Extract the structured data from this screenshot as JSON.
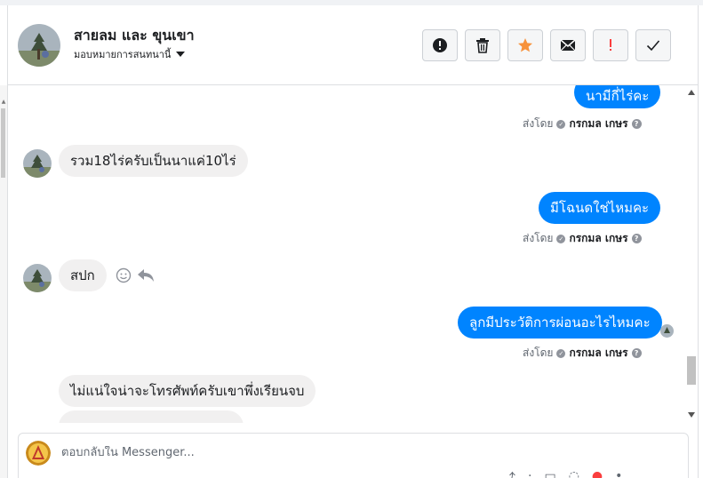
{
  "header": {
    "title": "สายลม และ ขุนเขา",
    "assign_label": "มอบหมายการสนทนานี้"
  },
  "actions": [
    {
      "name": "report-spam-button",
      "icon": "!",
      "icon_name": "exclamation-circle-icon",
      "color": "#1c1e21"
    },
    {
      "name": "delete-button",
      "icon": "🗑",
      "icon_name": "trash-icon",
      "color": "#1c1e21"
    },
    {
      "name": "star-button",
      "icon": "★",
      "icon_name": "star-icon",
      "color": "#f7923b"
    },
    {
      "name": "mark-unread-button",
      "icon": "✉",
      "icon_name": "envelope-icon",
      "color": "#1c1e21"
    },
    {
      "name": "follow-up-button",
      "icon": "!",
      "icon_name": "red-exclamation-icon",
      "color": "#fa3e3e"
    },
    {
      "name": "mark-done-button",
      "icon": "✓",
      "icon_name": "checkmark-icon",
      "color": "#1c1e21"
    }
  ],
  "messages": {
    "m1": "นามีกี่ไร่คะ",
    "m2": "รวม18ไร่ครับเป็นนาแค่10ไร่",
    "m3": "มีโฉนดใช่ไหมคะ",
    "m4": "สปก",
    "m5": "ลูกมีประวัติการผ่อนอะไรไหมคะ",
    "m6": "ไม่แน่ใจน่าจะโทรศัพท์ครับเขาพึ่งเรียนจบ"
  },
  "sent_by": {
    "label": "ส่งโดย",
    "name": "กรกมล เกษร",
    "help": "?"
  },
  "composer": {
    "placeholder": "ตอบกลับใน Messenger..."
  },
  "colors": {
    "accent": "#0084ff",
    "incoming_bubble": "#f1f0f0",
    "star": "#f7923b",
    "alert": "#fa3e3e"
  }
}
